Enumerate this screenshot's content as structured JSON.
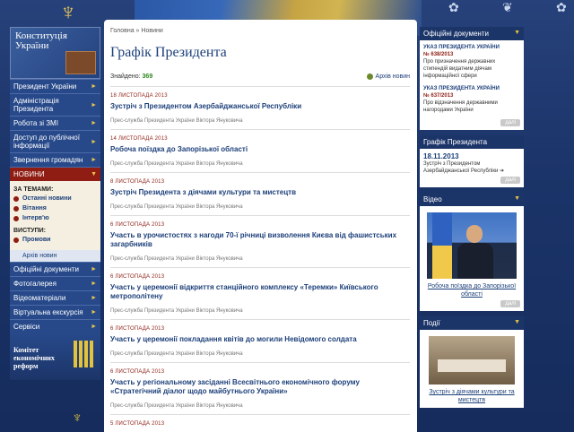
{
  "left": {
    "constitution_title": "Конституція України",
    "nav": [
      "Президент України",
      "Адміністрація Президента",
      "Робота зі ЗМІ",
      "Доступ до публічної інформації",
      "Звернення громадян"
    ],
    "active_section": "НОВИНИ",
    "by_topic_title": "ЗА ТЕМАМИ:",
    "topics": [
      "Останні новини",
      "Вітання",
      "Інтерв'ю"
    ],
    "speeches_title": "ВИСТУПИ:",
    "speeches": [
      "Промови"
    ],
    "archive": "Архів новин",
    "nav2": [
      "Офіційні документи",
      "Фотогалерея",
      "Відеоматеріали",
      "Віртуальна екскурсія",
      "Сервіси"
    ],
    "committee": "Комітет економічних реформ"
  },
  "main": {
    "breadcrumb_home": "Головна",
    "breadcrumb_sep": " » ",
    "breadcrumb_current": "Новини",
    "title": "Графік Президента",
    "found_label": "Знайдено: ",
    "found_count": "369",
    "archive_link": "Архів новин",
    "news": [
      {
        "date": "18 ЛИСТОПАДА 2013",
        "title": "Зустріч з Президентом Азербайджанської Республіки",
        "source": "Прес-служба Президента України Віктора Януковича"
      },
      {
        "date": "14 ЛИСТОПАДА 2013",
        "title": "Робоча поїздка до Запорізької області",
        "source": "Прес-служба Президента України Віктора Януковича"
      },
      {
        "date": "8 ЛИСТОПАДА 2013",
        "title": "Зустріч Президента з діячами культури та мистецтв",
        "source": "Прес-служба Президента України Віктора Януковича"
      },
      {
        "date": "6 ЛИСТОПАДА 2013",
        "title": "Участь в урочистостях з нагоди 70-ї річниці визволення Києва від фашистських загарбників",
        "source": "Прес-служба Президента України Віктора Януковича"
      },
      {
        "date": "6 ЛИСТОПАДА 2013",
        "title": "Участь у церемонії відкриття станційного комплексу «Теремки» Київського метрополітену",
        "source": "Прес-служба Президента України Віктора Януковича"
      },
      {
        "date": "6 ЛИСТОПАДА 2013",
        "title": "Участь у церемонії покладання квітів до могили Невідомого солдата",
        "source": "Прес-служба Президента України Віктора Януковича"
      },
      {
        "date": "6 ЛИСТОПАДА 2013",
        "title": "Участь у регіональному засіданні Всесвітнього економічного форуму «Стратегічний діалог щодо майбутнього України»",
        "source": "Прес-служба Президента України Віктора Януковича"
      },
      {
        "date": "5 ЛИСТОПАДА 2013",
        "title": "",
        "source": ""
      }
    ]
  },
  "right": {
    "docs_title": "Офіційні документи",
    "decrees": [
      {
        "head": "УКАЗ ПРЕЗИДЕНТА УКРАЇНИ",
        "num": "№ 638/2013",
        "text": "Про призначення державних стипендій видатним діячам інформаційної сфери"
      },
      {
        "head": "УКАЗ ПРЕЗИДЕНТА УКРАЇНИ",
        "num": "№ 637/2013",
        "text": "Про відзначення державними нагородами України"
      }
    ],
    "more": "далі",
    "schedule_title": "Графік Президента",
    "schedule_date": "18.11.2013",
    "schedule_text": "Зустріч з Президентом Азербайджанської Республіки ➔",
    "video_title": "Відео",
    "video_caption": "Робоча поїздка до Запорізької області",
    "events_title": "Події",
    "events_caption": "Зустріч з діячами культури та мистецтв"
  }
}
